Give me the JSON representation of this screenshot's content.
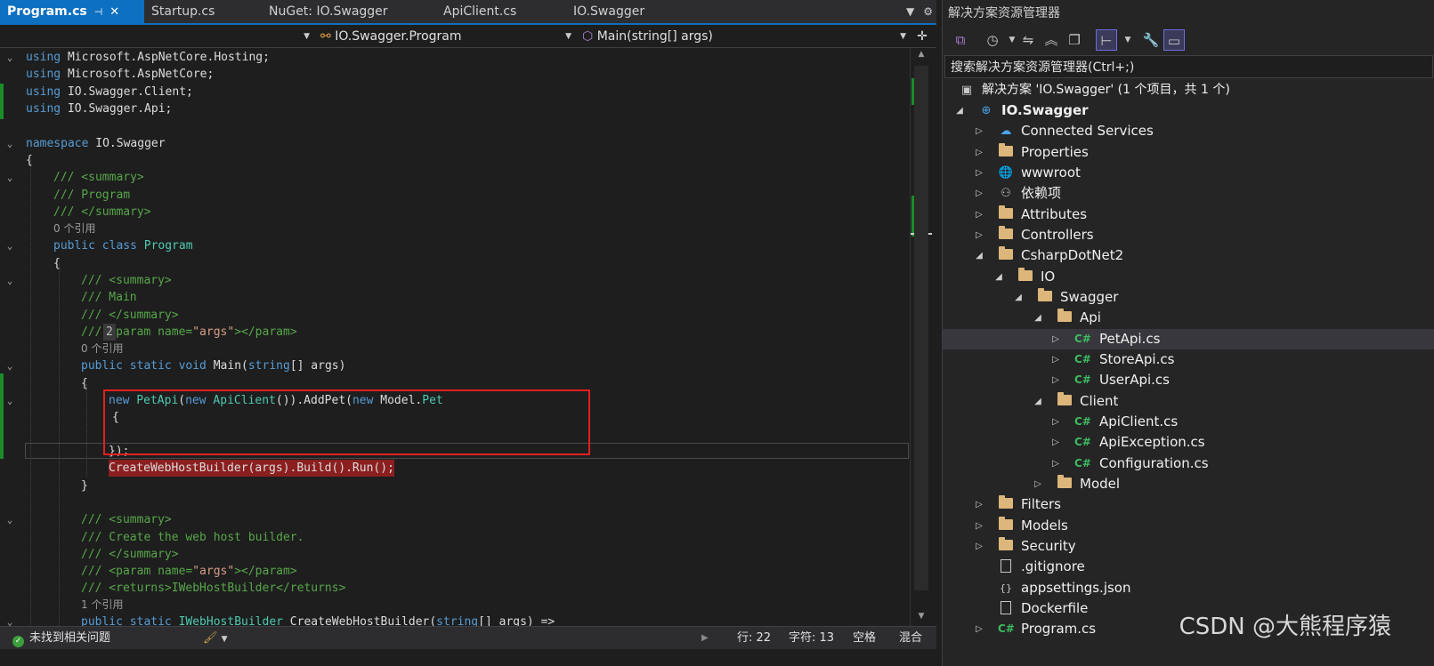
{
  "tabs": [
    {
      "label": "Program.cs",
      "active": true
    },
    {
      "label": "Startup.cs"
    },
    {
      "label": "NuGet: IO.Swagger"
    },
    {
      "label": "ApiClient.cs"
    },
    {
      "label": "IO.Swagger"
    }
  ],
  "navbar": {
    "class_path": "IO.Swagger.Program",
    "member": "Main(string[] args)"
  },
  "code": {
    "l1_kw": "using",
    "l1_rest": " Microsoft.AspNetCore.Hosting;",
    "l2_kw": "using",
    "l2_rest": " Microsoft.AspNetCore;",
    "l3_kw": "using",
    "l3_rest": " IO.Swagger.Client;",
    "l4_kw": "using",
    "l4_rest": " IO.Swagger.Api;",
    "l6_kw": "namespace",
    "l6_rest": " IO.Swagger",
    "l7": "{",
    "l8": "/// <summary>",
    "l9": "/// Program",
    "l10": "/// </summary>",
    "ref0": "0 个引用",
    "l12_kw": "public class",
    "l12_ty": " Program",
    "l13": "{",
    "l14": "/// <summary>",
    "l15": "/// Main",
    "l16": "/// </summary>",
    "l17_a": "/// <param name=",
    "l17_s": "\"args\"",
    "l17_b": "></param>",
    "l17_badge": "2",
    "ref1": "0 个引用",
    "l19_kw": "public static void",
    "l19_rest": " Main(",
    "l19_kw2": "string",
    "l19_rest2": "[] args)",
    "l20": "{",
    "l21_kw": "new",
    "l21_ty": " PetApi",
    "l21_p": "(",
    "l21_kw2": "new",
    "l21_ty2": " ApiClient",
    "l21_r": "()).AddPet(",
    "l21_kw3": "new",
    "l21_rest": " Model.",
    "l21_ty3": "Pet",
    "l22": "{",
    "l24": "});",
    "l25": "CreateWebHostBuilder(args).Build().Run();",
    "l26": "}",
    "l28": "/// <summary>",
    "l29": "/// Create the web host builder.",
    "l30": "/// </summary>",
    "l31_a": "/// <param name=",
    "l31_s": "\"args\"",
    "l31_b": "></param>",
    "l32": "/// <returns>IWebHostBuilder</returns>",
    "ref2": "1 个引用",
    "l34_kw": "public static",
    "l34_ty": " IWebHostBuilder",
    "l34_rest": " CreateWebHostBuilder(",
    "l34_kw2": "string",
    "l34_rest2": "[] args) =>"
  },
  "status": {
    "issues": "未找到相关问题",
    "line": "行: 22",
    "col": "字符: 13",
    "spaces": "空格",
    "eol": "混合"
  },
  "explorer": {
    "title": "解决方案资源管理器",
    "search_placeholder": "搜索解决方案资源管理器(Ctrl+;)",
    "solution": "解决方案 'IO.Swagger' (1 个项目，共 1 个)",
    "project": "IO.Swagger",
    "nodes": [
      "Connected Services",
      "Properties",
      "wwwroot",
      "依赖项",
      "Attributes",
      "Controllers",
      "CsharpDotNet2",
      "IO",
      "Swagger",
      "Api",
      "PetApi.cs",
      "StoreApi.cs",
      "UserApi.cs",
      "Client",
      "ApiClient.cs",
      "ApiException.cs",
      "Configuration.cs",
      "Model",
      "Filters",
      "Models",
      "Security",
      ".gitignore",
      "appsettings.json",
      "Dockerfile",
      "Program.cs"
    ],
    "cs_badge": "C#"
  },
  "watermark": "CSDN @大熊程序猿"
}
